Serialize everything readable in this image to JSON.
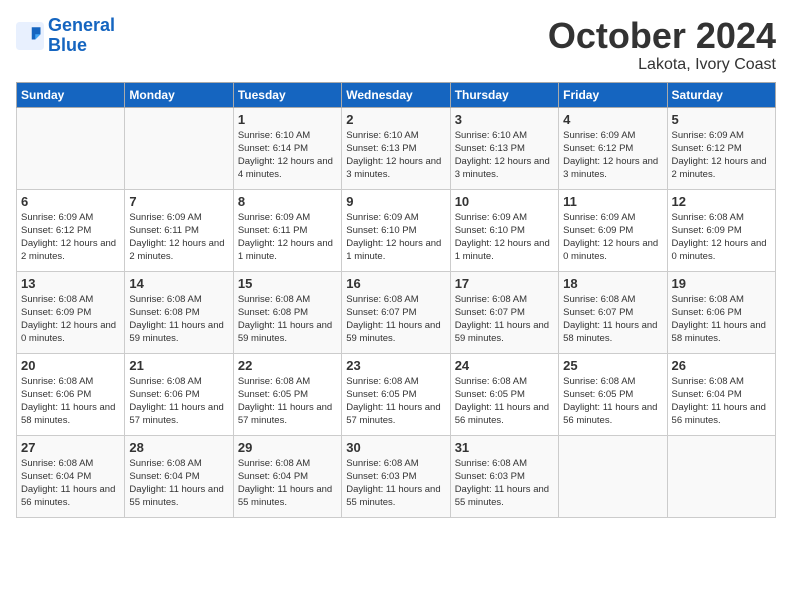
{
  "header": {
    "logo_line1": "General",
    "logo_line2": "Blue",
    "month": "October 2024",
    "location": "Lakota, Ivory Coast"
  },
  "days_of_week": [
    "Sunday",
    "Monday",
    "Tuesday",
    "Wednesday",
    "Thursday",
    "Friday",
    "Saturday"
  ],
  "weeks": [
    [
      {
        "day": "",
        "info": ""
      },
      {
        "day": "",
        "info": ""
      },
      {
        "day": "1",
        "info": "Sunrise: 6:10 AM\nSunset: 6:14 PM\nDaylight: 12 hours and 4 minutes."
      },
      {
        "day": "2",
        "info": "Sunrise: 6:10 AM\nSunset: 6:13 PM\nDaylight: 12 hours and 3 minutes."
      },
      {
        "day": "3",
        "info": "Sunrise: 6:10 AM\nSunset: 6:13 PM\nDaylight: 12 hours and 3 minutes."
      },
      {
        "day": "4",
        "info": "Sunrise: 6:09 AM\nSunset: 6:12 PM\nDaylight: 12 hours and 3 minutes."
      },
      {
        "day": "5",
        "info": "Sunrise: 6:09 AM\nSunset: 6:12 PM\nDaylight: 12 hours and 2 minutes."
      }
    ],
    [
      {
        "day": "6",
        "info": "Sunrise: 6:09 AM\nSunset: 6:12 PM\nDaylight: 12 hours and 2 minutes."
      },
      {
        "day": "7",
        "info": "Sunrise: 6:09 AM\nSunset: 6:11 PM\nDaylight: 12 hours and 2 minutes."
      },
      {
        "day": "8",
        "info": "Sunrise: 6:09 AM\nSunset: 6:11 PM\nDaylight: 12 hours and 1 minute."
      },
      {
        "day": "9",
        "info": "Sunrise: 6:09 AM\nSunset: 6:10 PM\nDaylight: 12 hours and 1 minute."
      },
      {
        "day": "10",
        "info": "Sunrise: 6:09 AM\nSunset: 6:10 PM\nDaylight: 12 hours and 1 minute."
      },
      {
        "day": "11",
        "info": "Sunrise: 6:09 AM\nSunset: 6:09 PM\nDaylight: 12 hours and 0 minutes."
      },
      {
        "day": "12",
        "info": "Sunrise: 6:08 AM\nSunset: 6:09 PM\nDaylight: 12 hours and 0 minutes."
      }
    ],
    [
      {
        "day": "13",
        "info": "Sunrise: 6:08 AM\nSunset: 6:09 PM\nDaylight: 12 hours and 0 minutes."
      },
      {
        "day": "14",
        "info": "Sunrise: 6:08 AM\nSunset: 6:08 PM\nDaylight: 11 hours and 59 minutes."
      },
      {
        "day": "15",
        "info": "Sunrise: 6:08 AM\nSunset: 6:08 PM\nDaylight: 11 hours and 59 minutes."
      },
      {
        "day": "16",
        "info": "Sunrise: 6:08 AM\nSunset: 6:07 PM\nDaylight: 11 hours and 59 minutes."
      },
      {
        "day": "17",
        "info": "Sunrise: 6:08 AM\nSunset: 6:07 PM\nDaylight: 11 hours and 59 minutes."
      },
      {
        "day": "18",
        "info": "Sunrise: 6:08 AM\nSunset: 6:07 PM\nDaylight: 11 hours and 58 minutes."
      },
      {
        "day": "19",
        "info": "Sunrise: 6:08 AM\nSunset: 6:06 PM\nDaylight: 11 hours and 58 minutes."
      }
    ],
    [
      {
        "day": "20",
        "info": "Sunrise: 6:08 AM\nSunset: 6:06 PM\nDaylight: 11 hours and 58 minutes."
      },
      {
        "day": "21",
        "info": "Sunrise: 6:08 AM\nSunset: 6:06 PM\nDaylight: 11 hours and 57 minutes."
      },
      {
        "day": "22",
        "info": "Sunrise: 6:08 AM\nSunset: 6:05 PM\nDaylight: 11 hours and 57 minutes."
      },
      {
        "day": "23",
        "info": "Sunrise: 6:08 AM\nSunset: 6:05 PM\nDaylight: 11 hours and 57 minutes."
      },
      {
        "day": "24",
        "info": "Sunrise: 6:08 AM\nSunset: 6:05 PM\nDaylight: 11 hours and 56 minutes."
      },
      {
        "day": "25",
        "info": "Sunrise: 6:08 AM\nSunset: 6:05 PM\nDaylight: 11 hours and 56 minutes."
      },
      {
        "day": "26",
        "info": "Sunrise: 6:08 AM\nSunset: 6:04 PM\nDaylight: 11 hours and 56 minutes."
      }
    ],
    [
      {
        "day": "27",
        "info": "Sunrise: 6:08 AM\nSunset: 6:04 PM\nDaylight: 11 hours and 56 minutes."
      },
      {
        "day": "28",
        "info": "Sunrise: 6:08 AM\nSunset: 6:04 PM\nDaylight: 11 hours and 55 minutes."
      },
      {
        "day": "29",
        "info": "Sunrise: 6:08 AM\nSunset: 6:04 PM\nDaylight: 11 hours and 55 minutes."
      },
      {
        "day": "30",
        "info": "Sunrise: 6:08 AM\nSunset: 6:03 PM\nDaylight: 11 hours and 55 minutes."
      },
      {
        "day": "31",
        "info": "Sunrise: 6:08 AM\nSunset: 6:03 PM\nDaylight: 11 hours and 55 minutes."
      },
      {
        "day": "",
        "info": ""
      },
      {
        "day": "",
        "info": ""
      }
    ]
  ]
}
